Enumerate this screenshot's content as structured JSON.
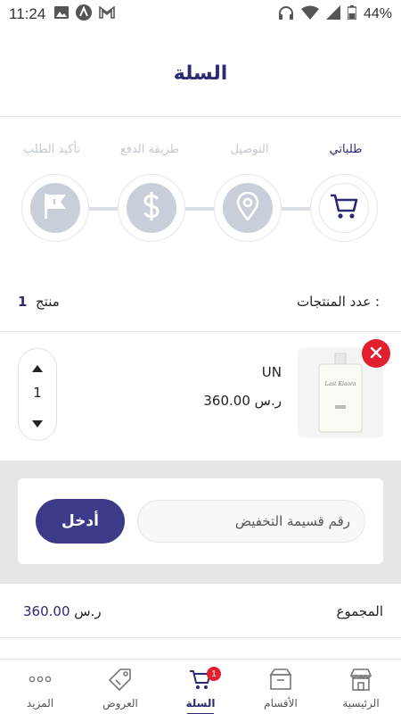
{
  "status_bar": {
    "time": "11:24",
    "battery": "44%",
    "left_icons": [
      "image-icon",
      "android-nav-icon",
      "gmail-icon"
    ],
    "right_icons": [
      "headphones-icon",
      "wifi-icon",
      "signal-icon",
      "battery-icon"
    ]
  },
  "header": {
    "title": "السلة"
  },
  "steps": [
    {
      "label": "طلباتي",
      "icon": "cart-icon",
      "active": true
    },
    {
      "label": "التوصيل",
      "icon": "location-pin-icon",
      "active": false
    },
    {
      "label": "طريقة الدفع",
      "icon": "dollar-icon",
      "active": false
    },
    {
      "label": "تأكيد الطلب",
      "icon": "flag-icon",
      "active": false
    }
  ],
  "product_count": {
    "label": "عدد المنتجات :",
    "value": "1",
    "unit": "منتج"
  },
  "cart_items": [
    {
      "name": "UN",
      "price": "360.00",
      "currency": "ر.س",
      "quantity": "1",
      "image_label": "Last Kiaora"
    }
  ],
  "coupon": {
    "placeholder": "رقم قسيمة التخفيض",
    "button_label": "أدخل"
  },
  "total": {
    "label": "المجموع",
    "value": "360.00",
    "currency": "ر.س"
  },
  "bottom_nav": {
    "items": [
      {
        "label": "الرئيسية",
        "icon": "store-icon"
      },
      {
        "label": "الأقسام",
        "icon": "box-icon"
      },
      {
        "label": "السلة",
        "icon": "cart-icon",
        "active": true,
        "badge": "1"
      },
      {
        "label": "العروض",
        "icon": "tag-icon"
      },
      {
        "label": "المزيد",
        "icon": "more-dots-icon"
      }
    ]
  },
  "colors": {
    "primary": "#2b2a72",
    "button": "#3e3a8a",
    "danger": "#e0202e",
    "inactive": "#c9cfd8"
  }
}
